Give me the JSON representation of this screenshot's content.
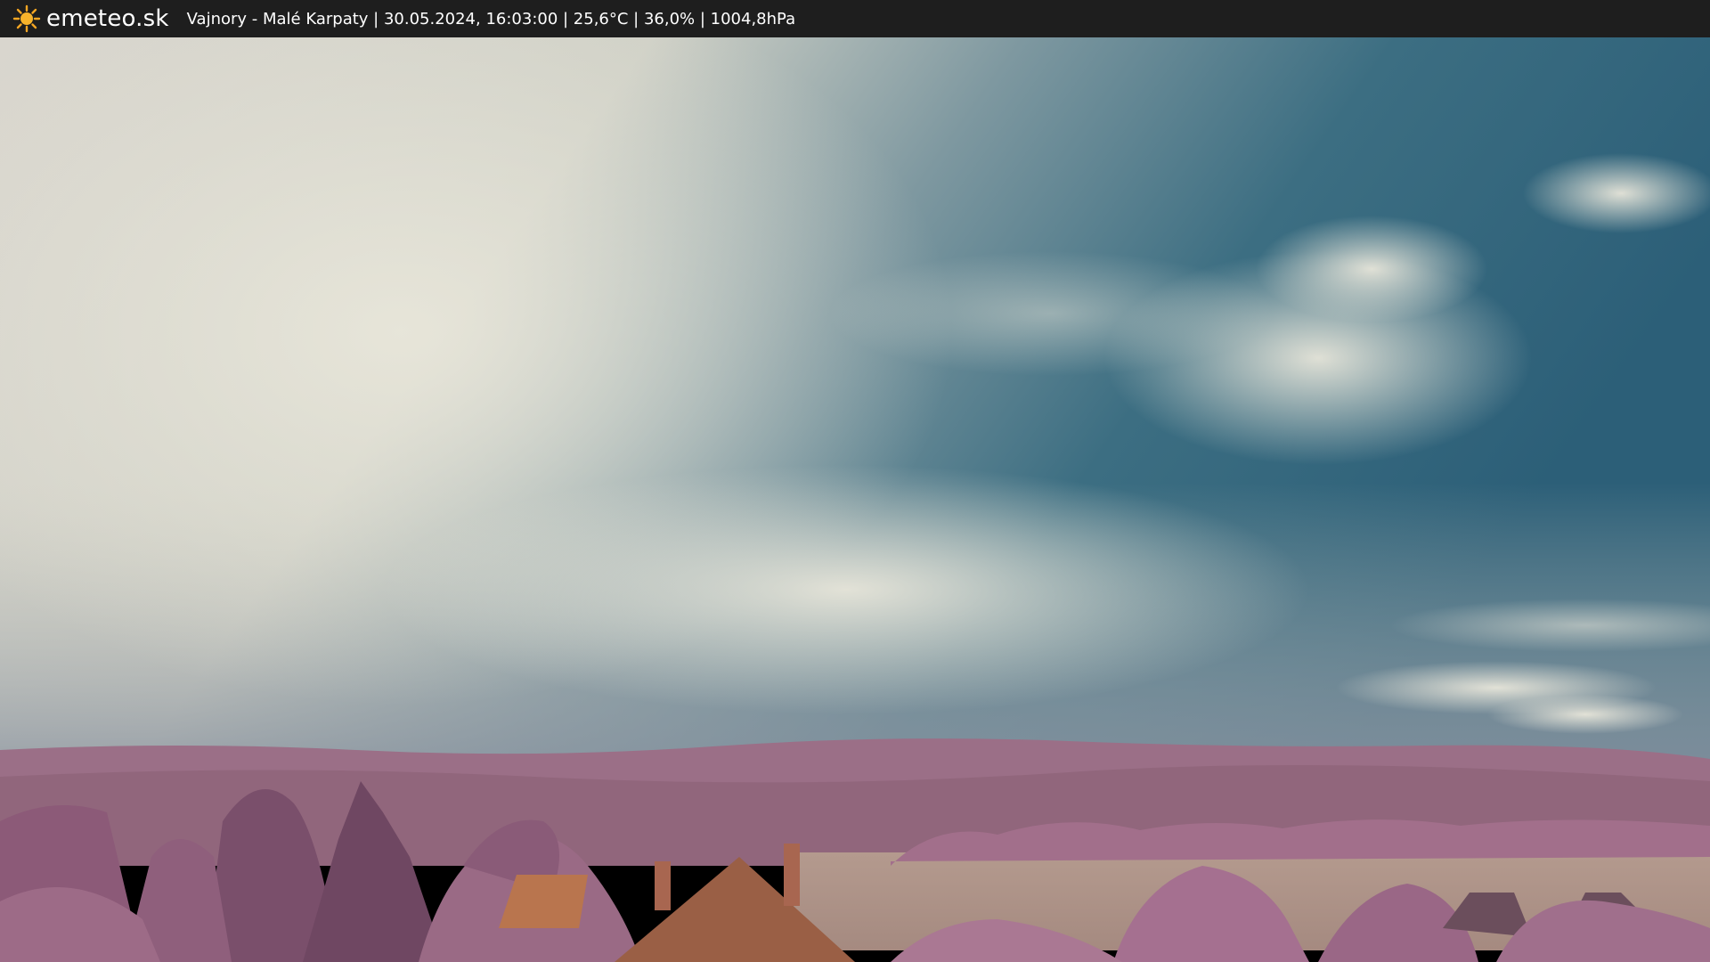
{
  "header": {
    "brand": "emeteo.sk",
    "logo_icon": "sun-icon",
    "station": "Vajnory - Malé Karpaty",
    "datetime": "30.05.2024, 16:03:00",
    "temperature": "25,6°C",
    "humidity": "36,0%",
    "pressure": "1004,8hPa",
    "info_line": "Vajnory - Malé Karpaty | 30.05.2024, 16:03:00 | 25,6°C | 36,0% | 1004,8hPa"
  },
  "colors": {
    "bar": "#1e1e1e",
    "sun": "#f5a623",
    "sky_blue": "#2f6f84",
    "cloud": "#dcdcd0",
    "foliage": "#a07088",
    "hills": "#9a6f86",
    "field": "#b0968a"
  }
}
